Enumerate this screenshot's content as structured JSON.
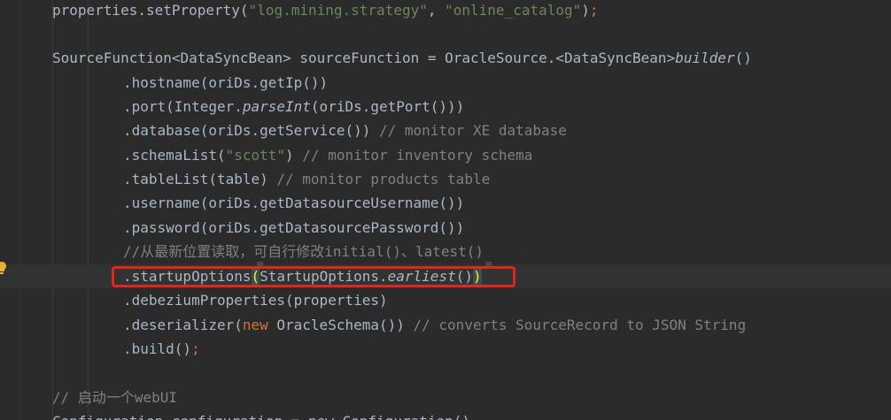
{
  "editor": {
    "lines": [
      {
        "id": "l1",
        "tokens": [
          {
            "t": "properties.setProperty(",
            "c": "plain"
          },
          {
            "t": "\"log.mining.strategy\"",
            "c": "str"
          },
          {
            "t": ", ",
            "c": "plain"
          },
          {
            "t": "\"online_catalog\"",
            "c": "str"
          },
          {
            "t": ")",
            "c": "plain"
          },
          {
            "t": ";",
            "c": "kw"
          }
        ]
      },
      {
        "id": "l2",
        "tokens": []
      },
      {
        "id": "l3",
        "tokens": [
          {
            "t": "SourceFunction<DataSyncBean> sourceFunction = OracleSource.<DataSyncBean>",
            "c": "plain"
          },
          {
            "t": "builder",
            "c": "plain",
            "i": true
          },
          {
            "t": "()",
            "c": "plain"
          }
        ]
      },
      {
        "id": "l4",
        "tokens": [
          {
            "t": ".hostname(oriDs.getIp())",
            "c": "plain"
          }
        ]
      },
      {
        "id": "l5",
        "tokens": [
          {
            "t": ".port(Integer.",
            "c": "plain"
          },
          {
            "t": "parseInt",
            "c": "plain",
            "i": true
          },
          {
            "t": "(oriDs.getPort()))",
            "c": "plain"
          }
        ]
      },
      {
        "id": "l6",
        "tokens": [
          {
            "t": ".database(oriDs.getService()) ",
            "c": "plain"
          },
          {
            "t": "// monitor XE database",
            "c": "cmt"
          }
        ]
      },
      {
        "id": "l7",
        "tokens": [
          {
            "t": ".schemaList(",
            "c": "plain"
          },
          {
            "t": "\"scott\"",
            "c": "str"
          },
          {
            "t": ") ",
            "c": "plain"
          },
          {
            "t": "// monitor inventory schema",
            "c": "cmt"
          }
        ]
      },
      {
        "id": "l8",
        "tokens": [
          {
            "t": ".tableList(table) ",
            "c": "plain"
          },
          {
            "t": "// monitor products table",
            "c": "cmt"
          }
        ]
      },
      {
        "id": "l9",
        "tokens": [
          {
            "t": ".username(oriDs.getDatasourceUsername())",
            "c": "plain"
          }
        ]
      },
      {
        "id": "l10",
        "tokens": [
          {
            "t": ".password(oriDs.getDatasourcePassword())",
            "c": "plain"
          }
        ]
      },
      {
        "id": "l11",
        "tokens": [
          {
            "t": "//从最新位置读取，可自行修改initial()、latest()",
            "c": "cmt"
          }
        ]
      },
      {
        "id": "l12",
        "tokens": [
          {
            "t": ".startupOptions",
            "c": "plain"
          },
          {
            "t": "(",
            "c": "brace"
          },
          {
            "t": "StartupOptions.",
            "c": "plain"
          },
          {
            "t": "earliest",
            "c": "plain",
            "i": true
          },
          {
            "t": "()",
            "c": "plain"
          },
          {
            "t": ")",
            "c": "brace"
          }
        ]
      },
      {
        "id": "l13",
        "tokens": [
          {
            "t": ".debeziumProperties(properties)",
            "c": "plain"
          }
        ]
      },
      {
        "id": "l14",
        "tokens": [
          {
            "t": ".deserializer(",
            "c": "plain"
          },
          {
            "t": "new ",
            "c": "kw"
          },
          {
            "t": "OracleSchema()) ",
            "c": "plain"
          },
          {
            "t": "// converts SourceRecord to JSON String",
            "c": "cmt"
          }
        ]
      },
      {
        "id": "l15",
        "tokens": [
          {
            "t": ".build()",
            "c": "plain"
          },
          {
            "t": ";",
            "c": "kw"
          }
        ]
      },
      {
        "id": "l16",
        "tokens": []
      },
      {
        "id": "l17",
        "tokens": [
          {
            "t": "// 启动一个webUI",
            "c": "cmt"
          }
        ]
      },
      {
        "id": "l18",
        "tokens": [
          {
            "t": "Configuration configuration = new Configuration()",
            "c": "plain"
          }
        ]
      }
    ]
  },
  "colors": {
    "background": "#2b2b2b",
    "plain": "#a9b7c6",
    "string": "#6a8759",
    "comment": "#808080",
    "keyword": "#cc7832",
    "highlight_box": "#e0261d",
    "intention_bulb": "#e8b230"
  },
  "icons": {
    "intention": "lightbulb-icon"
  }
}
